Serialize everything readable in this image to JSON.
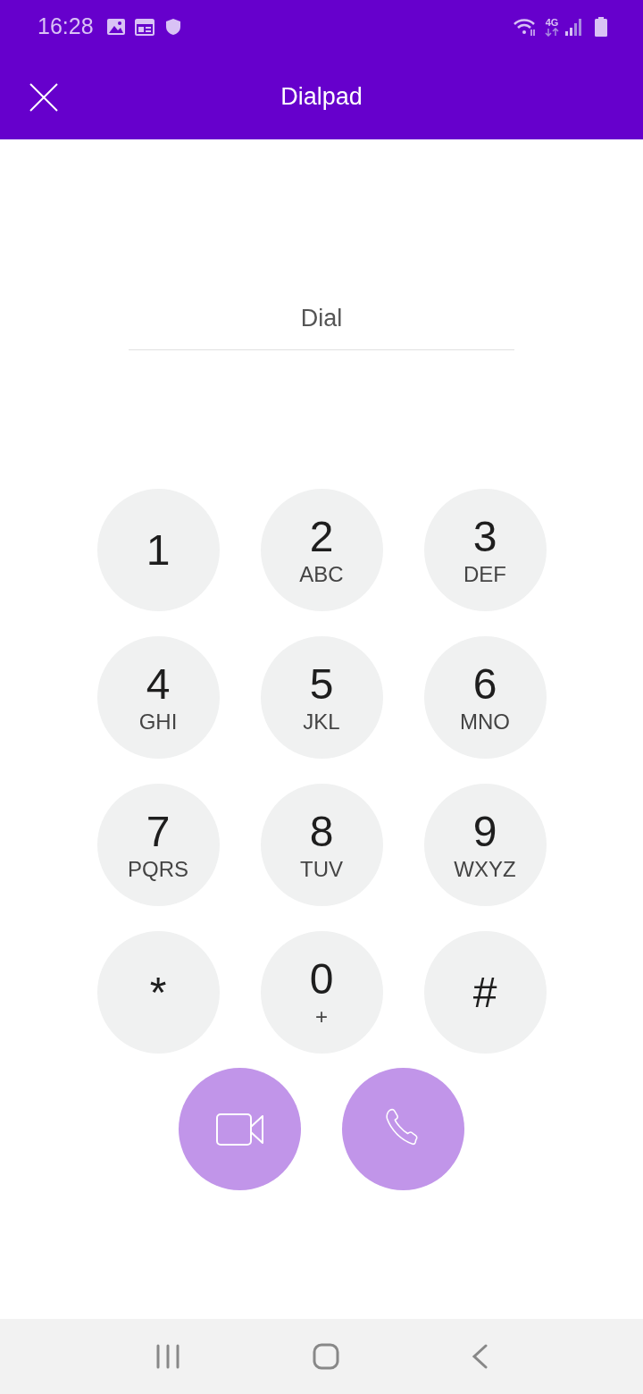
{
  "status_bar": {
    "time": "16:28",
    "network": "4G"
  },
  "app_bar": {
    "title": "Dialpad"
  },
  "dial_field": {
    "placeholder": "Dial"
  },
  "keys": [
    {
      "digit": "1"
    },
    {
      "digit": "2",
      "letters": "ABC"
    },
    {
      "digit": "3",
      "letters": "DEF"
    },
    {
      "digit": "4",
      "letters": "GHI"
    },
    {
      "digit": "5",
      "letters": "JKL"
    },
    {
      "digit": "6",
      "letters": "MNO"
    },
    {
      "digit": "7",
      "letters": "PQRS"
    },
    {
      "digit": "8",
      "letters": "TUV"
    },
    {
      "digit": "9",
      "letters": "WXYZ"
    },
    {
      "digit": "*"
    },
    {
      "digit": "0",
      "letters": "+"
    },
    {
      "digit": "#"
    }
  ],
  "call_buttons": [
    {
      "kind": "video"
    },
    {
      "kind": "voice"
    }
  ]
}
